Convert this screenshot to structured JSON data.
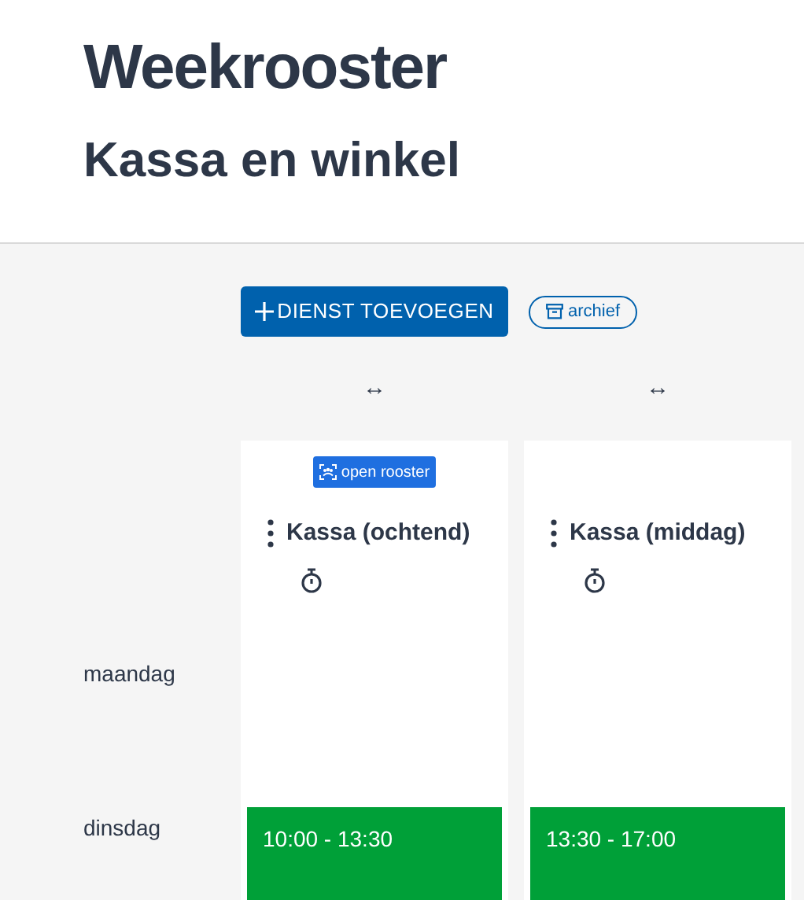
{
  "title": "Weekrooster",
  "subtitle": "Kassa en winkel",
  "add_button": "DIENST TOEVOEGEN",
  "archive_button": "archief",
  "columns": [
    {
      "handle": "↔",
      "badge": "open rooster",
      "name": "Kassa (ochtend)"
    },
    {
      "handle": "↔",
      "name": "Kassa (middag)"
    }
  ],
  "rows": [
    {
      "day": "maandag"
    },
    {
      "day": "dinsdag",
      "shifts": [
        "10:00 - 13:30",
        "13:30 - 17:00"
      ]
    }
  ]
}
